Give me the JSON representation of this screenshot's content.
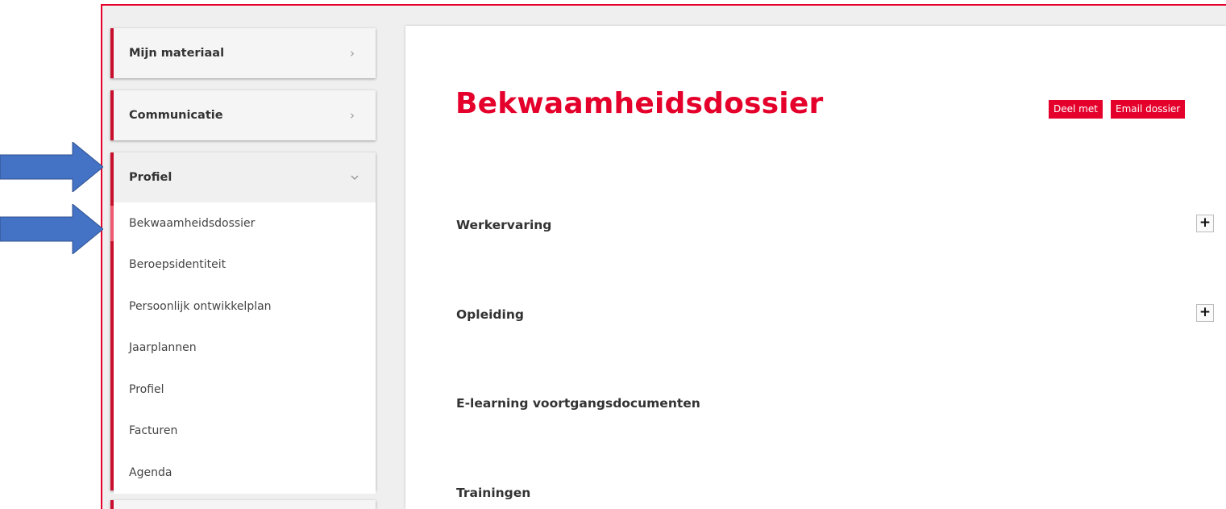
{
  "sidebar": {
    "cards": [
      {
        "label": "Mijn materiaal"
      },
      {
        "label": "Communicatie"
      },
      {
        "label": "Profiel"
      }
    ],
    "submenu": [
      {
        "label": "Bekwaamheidsdossier"
      },
      {
        "label": "Beroepsidentiteit"
      },
      {
        "label": "Persoonlijk ontwikkelplan"
      },
      {
        "label": "Jaarplannen"
      },
      {
        "label": "Profiel"
      },
      {
        "label": "Facturen"
      },
      {
        "label": "Agenda"
      }
    ]
  },
  "main": {
    "title": "Bekwaamheidsdossier",
    "share_label": "Deel met",
    "email_label": "Email dossier",
    "sections": [
      {
        "label": "Werkervaring"
      },
      {
        "label": "Opleiding"
      },
      {
        "label": "E-learning voortgangsdocumenten"
      },
      {
        "label": "Trainingen"
      }
    ],
    "expand_symbol": "+"
  },
  "colors": {
    "accent": "#e4002b",
    "arrow": "#4472c4",
    "active_indicator": "#f05a70"
  }
}
